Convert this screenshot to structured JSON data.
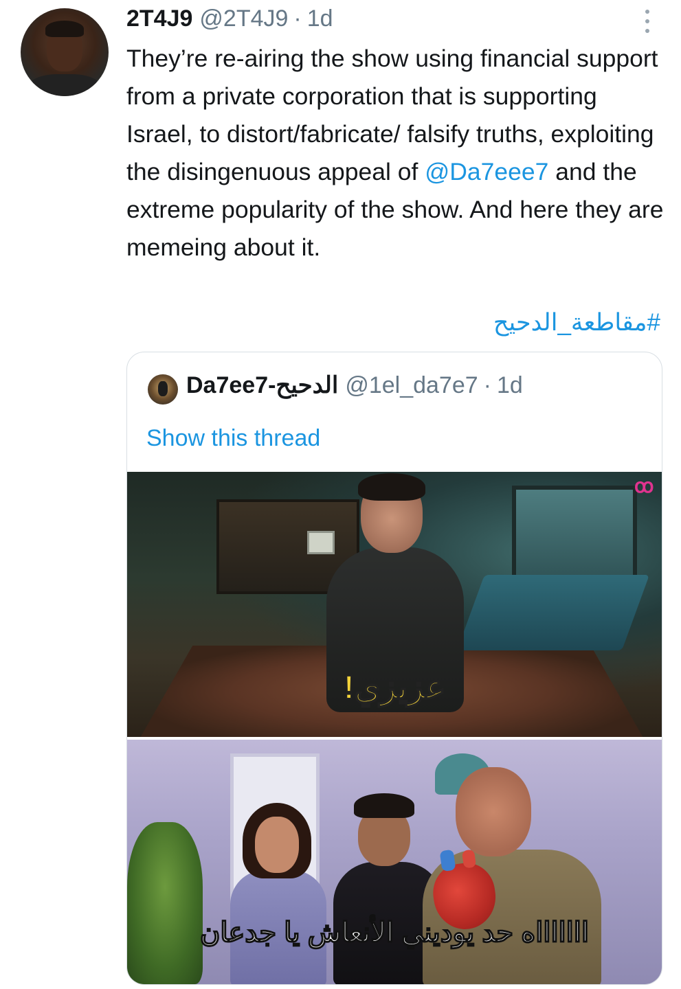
{
  "tweet": {
    "author_name": "2T4J9",
    "author_handle": "@2T4J9",
    "separator": "·",
    "time": "1d",
    "text_before_mention": "They’re re-airing the show using financial support from a private corporation that is supporting Israel, to distort/fabricate/ falsify truths, exploiting the disingenuous appeal of ",
    "mention": "@Da7eee7",
    "text_after_mention": " and the extreme popularity of the show. And here they are memeing about it.",
    "hashtag": "#مقاطعة_الدحيح"
  },
  "quoted_tweet": {
    "author_name": "Da7ee7-الدحيح",
    "author_handle": "@1el_da7e7",
    "separator": "·",
    "time": "1d",
    "show_thread": "Show this thread",
    "media": [
      {
        "caption": "عزيزي!",
        "logo": "ꝏ"
      },
      {
        "caption": "اااااااه حد يوديني الأنعاش يا جدعان"
      }
    ]
  },
  "icons": {
    "more": "vertical-dots",
    "logo_color": "#e0338f"
  },
  "colors": {
    "link": "#1b95e0",
    "secondary_text": "#657786"
  }
}
